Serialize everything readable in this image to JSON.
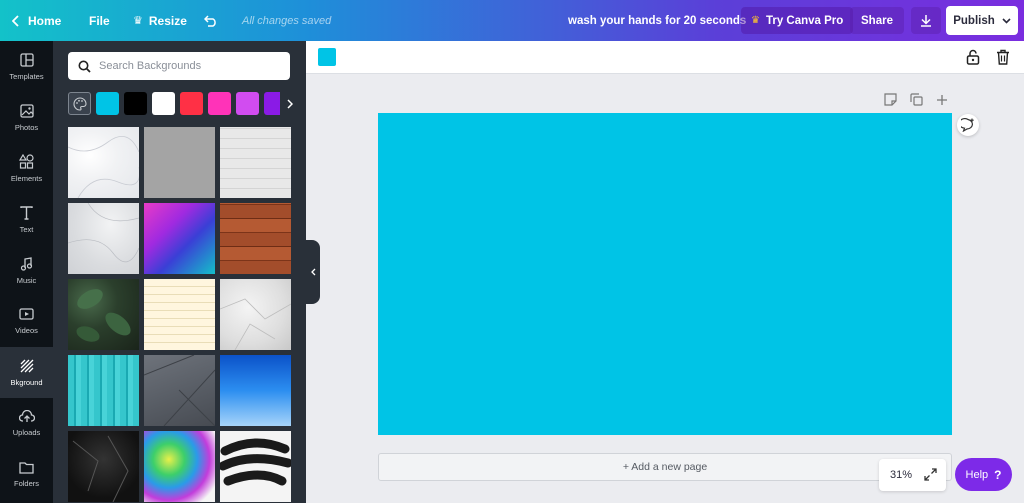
{
  "topbar": {
    "home_label": "Home",
    "file_label": "File",
    "resize_label": "Resize",
    "saved_status": "All changes saved",
    "design_title": "wash your hands for 20 seconds",
    "try_pro_label": "Try Canva Pro",
    "share_label": "Share",
    "publish_label": "Publish"
  },
  "sidebar": {
    "items": [
      {
        "label": "Templates",
        "icon": "templates-icon"
      },
      {
        "label": "Photos",
        "icon": "photos-icon"
      },
      {
        "label": "Elements",
        "icon": "elements-icon"
      },
      {
        "label": "Text",
        "icon": "text-icon"
      },
      {
        "label": "Music",
        "icon": "music-icon"
      },
      {
        "label": "Videos",
        "icon": "videos-icon"
      },
      {
        "label": "Bkground",
        "icon": "background-icon",
        "active": true
      },
      {
        "label": "Uploads",
        "icon": "uploads-icon"
      },
      {
        "label": "Folders",
        "icon": "folders-icon"
      }
    ]
  },
  "panel": {
    "search_placeholder": "Search Backgrounds",
    "swatch_colors": [
      "#00c4e6",
      "#000000",
      "#ffffff",
      "#ff3045",
      "#ff33b8",
      "#d14cf0",
      "#8a1be6"
    ],
    "backgrounds": [
      "white marble",
      "gray solid",
      "white brick",
      "gray marble",
      "color gradient",
      "wood planks",
      "green leaves",
      "lined paper",
      "crumpled paper",
      "teal painted wood",
      "gray geometric",
      "blue sky gradient",
      "black texture",
      "colorful smoke",
      "black brush stroke"
    ]
  },
  "editor": {
    "selected_color": "#00c4e6",
    "canvas_color": "#00c4e6",
    "add_page_label": "+ Add a new page",
    "zoom_value": "31%",
    "help_label": "Help",
    "help_symbol": "?"
  }
}
